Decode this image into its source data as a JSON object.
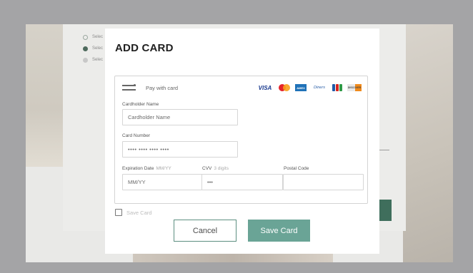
{
  "background": {
    "steps": [
      {
        "label": "Selec"
      },
      {
        "label": "Selec"
      },
      {
        "label": "Selec"
      }
    ]
  },
  "modal": {
    "title": "ADD CARD",
    "pay_with": "Pay with card",
    "brands": [
      {
        "name": "visa-logo",
        "text": "VISA"
      },
      {
        "name": "mastercard-logo",
        "text": ""
      },
      {
        "name": "amex-logo",
        "text": "AMEX"
      },
      {
        "name": "diners-logo",
        "text": "Diners"
      },
      {
        "name": "jcb-logo",
        "text": ""
      },
      {
        "name": "discover-logo",
        "text": "DISCOVER"
      }
    ],
    "cardholder": {
      "label": "Cardholder Name",
      "placeholder": "Cardholder Name"
    },
    "card_number": {
      "label": "Card Number",
      "placeholder": "•••• •••• •••• ••••"
    },
    "expiration": {
      "label": "Expiration Date",
      "hint": "MM/YY",
      "placeholder": "MM/YY"
    },
    "cvv": {
      "label": "CVV",
      "hint": "3 digits",
      "placeholder": "•••"
    },
    "postal": {
      "label": "Postal Code",
      "placeholder": ""
    },
    "save_card_checkbox": {
      "label": "Save Card",
      "checked": false
    },
    "cancel_label": "Cancel",
    "save_label": "Save Card"
  },
  "colors": {
    "accent": "#6aa496",
    "accent_dark": "#3f6e5c",
    "overlay": "#a4a4a6"
  }
}
